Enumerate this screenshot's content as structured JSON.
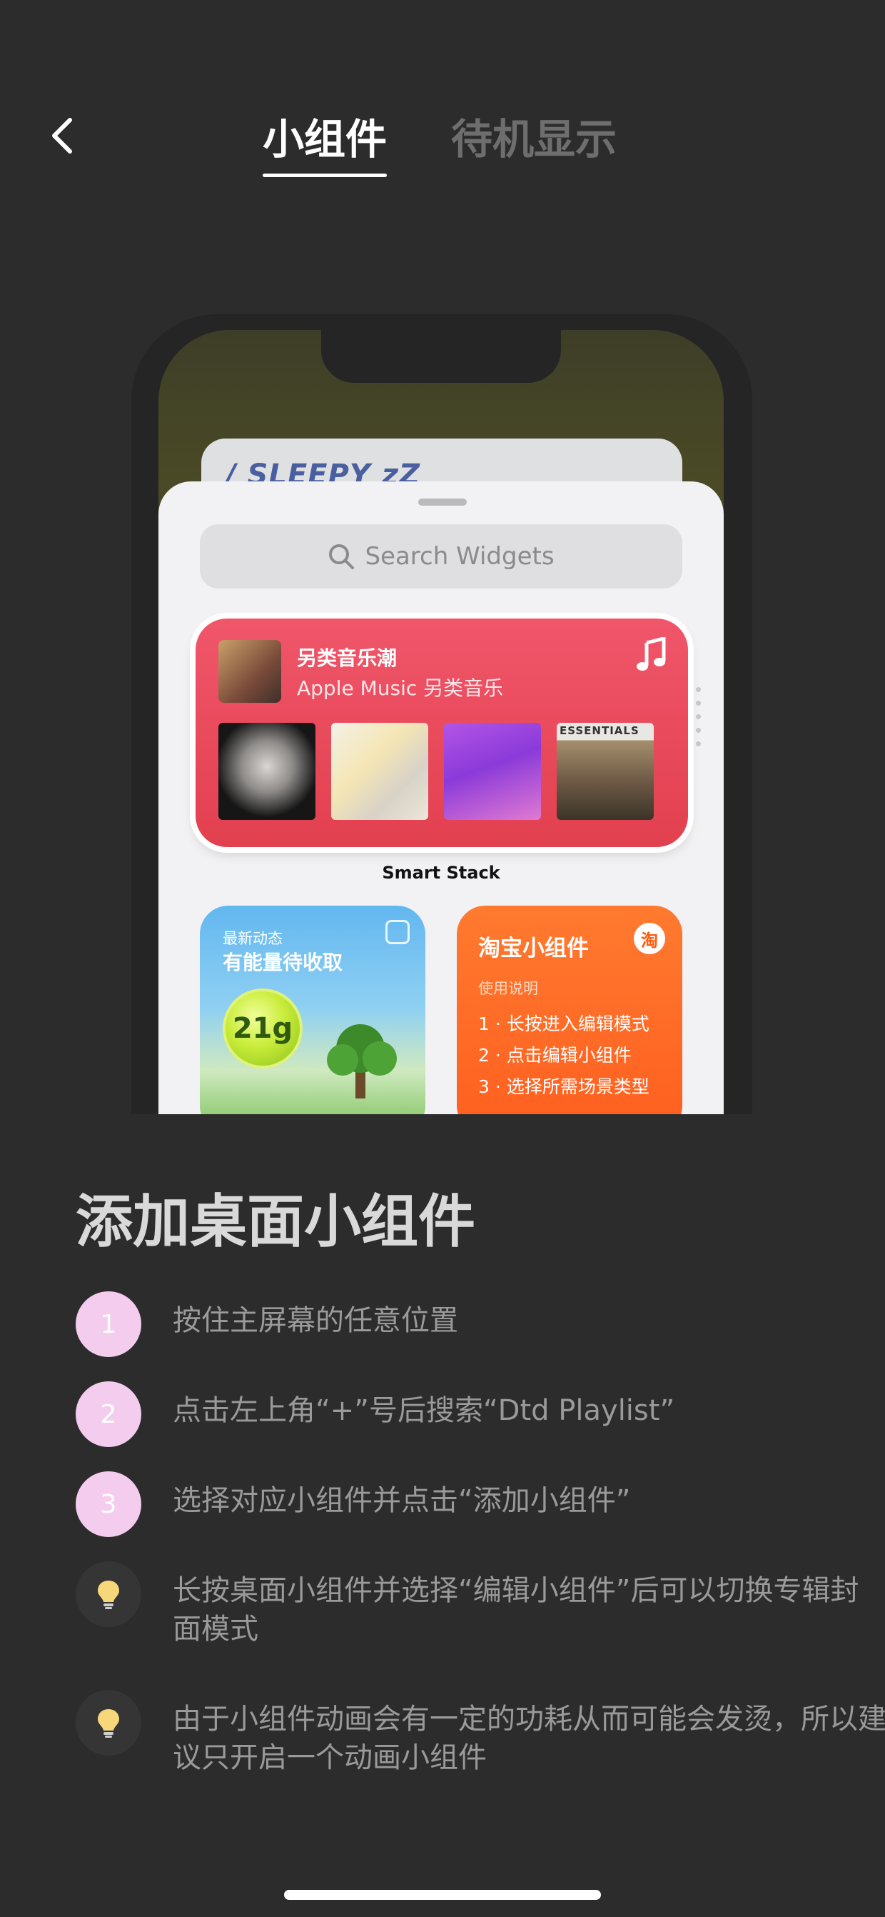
{
  "header": {
    "tabs": [
      {
        "label": "小组件",
        "active": true
      },
      {
        "label": "待机显示",
        "active": false
      }
    ]
  },
  "preview": {
    "back_widget_text": "/ SLEEPY  zZ",
    "search_placeholder": "Search Widgets",
    "smart_stack": {
      "title": "另类音乐潮",
      "subtitle": "Apple Music 另类音乐",
      "album4_label": "ESSENTIALS",
      "label": "Smart Stack"
    },
    "green_widget": {
      "top": "最新动态",
      "main": "有能量待收取",
      "energy": "21g"
    },
    "orange_widget": {
      "title": "淘宝小组件",
      "badge": "淘",
      "subtitle": "使用说明",
      "steps": [
        "1 · 长按进入编辑模式",
        "2 · 点击编辑小组件",
        "3 · 选择所需场景类型"
      ]
    }
  },
  "instructions": {
    "title": "添加桌面小组件",
    "steps": [
      {
        "number": "1",
        "text": "按住主屏幕的任意位置"
      },
      {
        "number": "2",
        "text": "点击左上角“+”号后搜索“Dtd Playlist”"
      },
      {
        "number": "3",
        "text": "选择对应小组件并点击“添加小组件”"
      }
    ],
    "tips": [
      {
        "icon": "lightbulb-icon",
        "text": "长按桌面小组件并选择“编辑小组件”后可以切换专辑封面模式"
      },
      {
        "icon": "lightbulb-icon",
        "text": "由于小组件动画会有一定的功耗从而可能会发烫，所以建议只开启一个动画小组件"
      }
    ]
  },
  "colors": {
    "background": "#2c2c2c",
    "step_badge": "#f4ccee",
    "stack_red": "#e8475a",
    "orange": "#ff6a25"
  }
}
